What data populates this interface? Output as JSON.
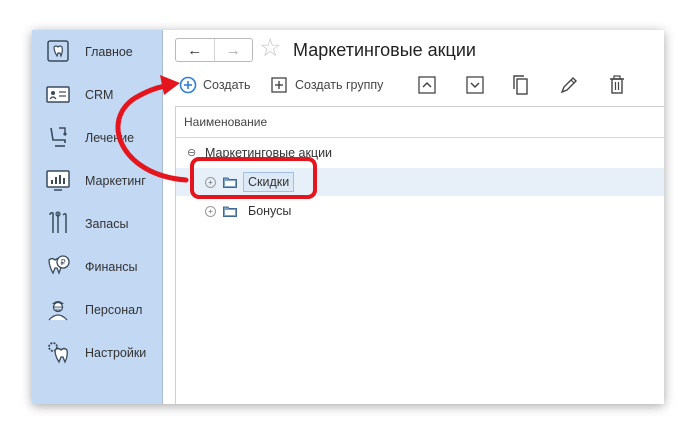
{
  "sidebar": {
    "items": [
      {
        "label": "Главное",
        "icon": "home-tooth-icon"
      },
      {
        "label": "CRM",
        "icon": "crm-card-icon"
      },
      {
        "label": "Лечение",
        "icon": "dental-chair-icon"
      },
      {
        "label": "Маркетинг",
        "icon": "marketing-chart-icon"
      },
      {
        "label": "Запасы",
        "icon": "dental-tools-icon"
      },
      {
        "label": "Финансы",
        "icon": "finance-tooth-icon"
      },
      {
        "label": "Персонал",
        "icon": "staff-doctor-icon"
      },
      {
        "label": "Настройки",
        "icon": "settings-tooth-icon"
      }
    ]
  },
  "header": {
    "title": "Маркетинговые акции",
    "back_icon": "←",
    "forward_icon": "→",
    "favorite_icon": "☆"
  },
  "toolbar": {
    "create_label": "Создать",
    "create_group_label": "Создать группу"
  },
  "list": {
    "column_header": "Наименование",
    "root": {
      "label": "Маркетинговые акции",
      "expander": "⊖"
    },
    "items": [
      {
        "label": "Скидки",
        "selected": true,
        "expander": "+"
      },
      {
        "label": "Бонусы",
        "selected": false,
        "expander": "+"
      }
    ]
  },
  "colors": {
    "sidebar_bg": "#c2d8f3",
    "accent_blue": "#2d7fd8",
    "annotation_red": "#e4151c",
    "selected_row": "#e7f0f9"
  }
}
